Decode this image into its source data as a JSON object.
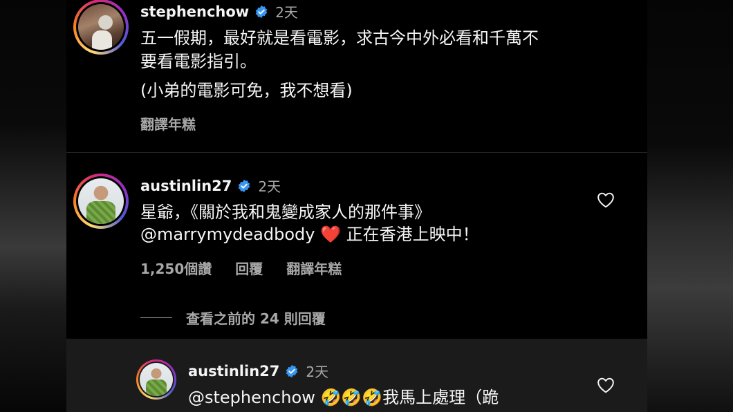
{
  "comments": [
    {
      "username": "stephenchow",
      "time": "2天",
      "text_lines": [
        "五一假期，最好就是看電影，求古今中外必看和千萬不",
        "要看電影指引。"
      ],
      "extra_line": "(小弟的電影可免，我不想看)",
      "actions": {
        "translate": "翻譯年糕"
      }
    },
    {
      "username": "austinlin27",
      "time": "2天",
      "text_lines": [
        "星爺，《關於我和鬼變成家人的那件事》"
      ],
      "mention": "@marrymydeadbody",
      "heart_emoji": "❤️",
      "after_heart": "正在香港上映中！",
      "actions": {
        "likes": "1,250個讚",
        "reply": "回覆",
        "translate": "翻譯年糕"
      }
    }
  ],
  "view_previous_replies": "查看之前的 24 則回覆",
  "reply": {
    "username": "austinlin27",
    "time": "2天",
    "mention": "@stephenchow",
    "emojis": [
      "🤣",
      "🤣",
      "🤣"
    ],
    "text": "我馬上處理（跪"
  },
  "colors": {
    "background": "#000000",
    "reply_highlight": "#1b1b1b",
    "verified": "#3897f0",
    "secondary_text": "#a8a8a8"
  }
}
